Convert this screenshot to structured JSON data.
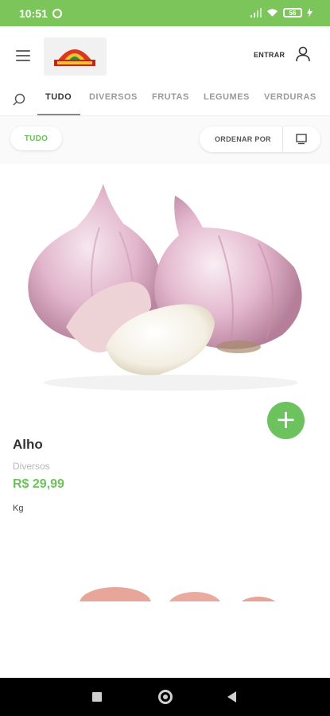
{
  "status_bar": {
    "time": "10:51",
    "battery": "56",
    "icons": [
      "alarm-icon",
      "signal-icon",
      "wifi-icon",
      "battery-icon",
      "bolt-icon"
    ]
  },
  "header": {
    "login_label": "ENTRAR",
    "icons": [
      "menu-icon",
      "store-logo",
      "user-icon"
    ]
  },
  "categories": {
    "tabs": [
      "TUDO",
      "DIVERSOS",
      "FRUTAS",
      "LEGUMES",
      "VERDURAS"
    ],
    "active_tab": "TUDO"
  },
  "filters": {
    "chip_label": "TUDO",
    "sort_label": "ORDENAR POR",
    "view_icon": "grid-view-icon"
  },
  "product": {
    "name": "Alho",
    "category": "Diversos",
    "price": "R$ 29,99",
    "unit": "Kg",
    "add_icon": "+"
  },
  "colors": {
    "brand_green": "#7cc55a",
    "price_green": "#6cc25c",
    "nav_black": "#000000"
  }
}
